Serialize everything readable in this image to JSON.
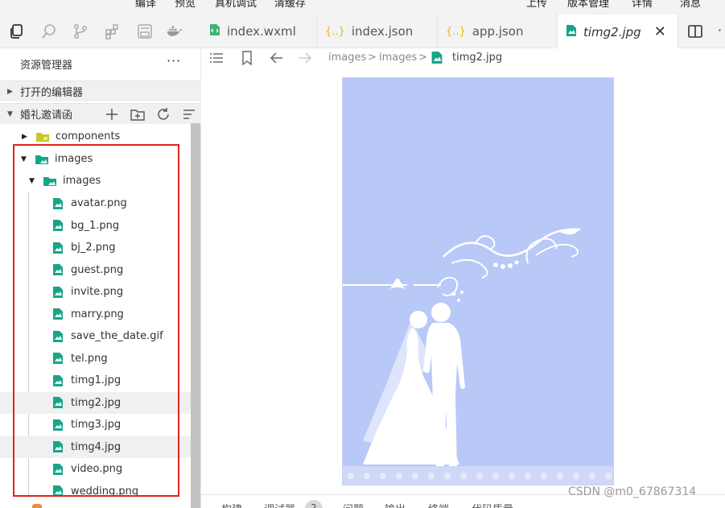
{
  "menubar": {
    "items": [
      "编译",
      "预览",
      "真机调试",
      "清缓存",
      "上传",
      "版本管理",
      "详情",
      "消息"
    ]
  },
  "tabs": [
    {
      "label": "index.wxml",
      "icon": "wxml-file-icon",
      "icon_color": "#3cb371"
    },
    {
      "label": "index.json",
      "icon": "json-file-icon",
      "icon_color": "#f0b400"
    },
    {
      "label": "app.json",
      "icon": "json-file-icon",
      "icon_color": "#f0b400"
    },
    {
      "label": "timg2.jpg",
      "icon": "image-file-icon",
      "icon_color": "#17a589",
      "active": true
    }
  ],
  "sidebar": {
    "title": "资源管理器",
    "more": "···",
    "open_editors": "打开的编辑器",
    "project": "婚礼邀请函",
    "tree": {
      "components": "components",
      "images_outer": "images",
      "images_inner": "images",
      "files": [
        "avatar.png",
        "bg_1.png",
        "bj_2.png",
        "guest.png",
        "invite.png",
        "marry.png",
        "save_the_date.gif",
        "tel.png",
        "timg1.jpg",
        "timg2.jpg",
        "timg3.jpg",
        "timg4.jpg",
        "video.png",
        "wedding.png"
      ]
    }
  },
  "breadcrumb": {
    "parts": [
      "images",
      "images",
      "timg2.jpg"
    ],
    "separator": ">"
  },
  "bottom_panel": {
    "tabs": [
      "构建",
      "调试器",
      "问题",
      "输出",
      "终端",
      "代码质量"
    ],
    "badge": "2"
  },
  "watermark": "CSDN @m0_67867314",
  "colors": {
    "accent_red": "#e0251b",
    "preview_bg": "#b8c8f7",
    "folder_green": "#17a589",
    "components_folder": "#c7c92a"
  }
}
